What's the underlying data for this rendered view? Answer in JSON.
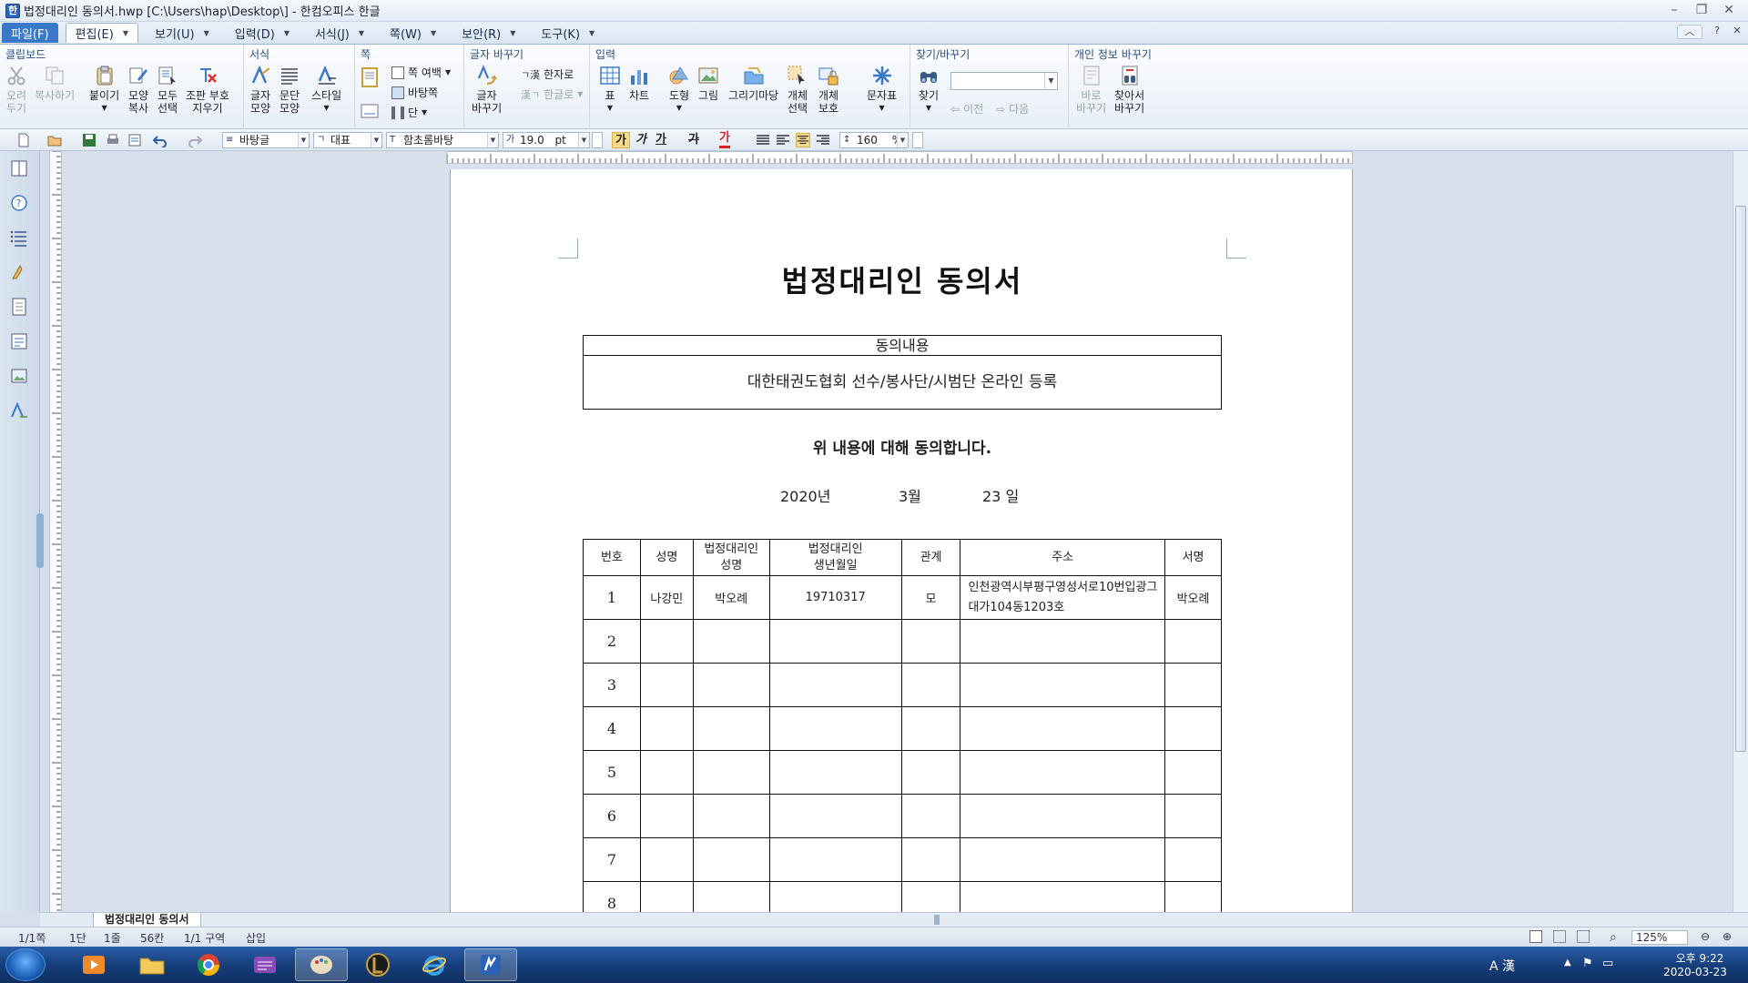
{
  "window": {
    "title": "법정대리인 동의서.hwp [C:\\Users\\hap\\Desktop\\] - 한컴오피스 한글"
  },
  "menu": [
    "파일(F)",
    "편집(E)",
    "보기(U)",
    "입력(D)",
    "서식(J)",
    "쪽(W)",
    "보안(R)",
    "도구(K)"
  ],
  "ribbon": {
    "groups": {
      "clipboard": "클립보드",
      "format": "서식",
      "page": "쪽",
      "char_replace": "글자 바꾸기",
      "insert": "입력",
      "find": "찾기/바꾸기",
      "privacy": "개인 정보 바꾸기"
    },
    "cut": [
      "오려",
      "두기"
    ],
    "copy": "복사하기",
    "paste": "붙이기",
    "shape_copy": [
      "모양",
      "복사"
    ],
    "select_all": [
      "모두",
      "선택"
    ],
    "clear_format": [
      "조판 부호",
      "지우기"
    ],
    "char_shape": [
      "글자",
      "모양"
    ],
    "para_shape": [
      "문단",
      "모양"
    ],
    "style": "스타일",
    "page_margin": "쪽 여백",
    "background_page": "바탕쪽",
    "column": "단",
    "char_convert": [
      "글자",
      "바꾸기"
    ],
    "hanja": "한자로",
    "hangul": "한글로",
    "table": "표",
    "chart": "차트",
    "shape": "도형",
    "picture": "그림",
    "drawing_gallery": "그리기마당",
    "object_select": [
      "개체",
      "선택"
    ],
    "object_protect": [
      "개체",
      "보호"
    ],
    "symbol": "문자표",
    "find": "찾기",
    "prev": "이전",
    "next": "다음",
    "replace_now": [
      "바로",
      "바꾸기"
    ],
    "find_replace": [
      "찾아서",
      "바꾸기"
    ]
  },
  "toolbar": {
    "style": "바탕글",
    "lang": "대표",
    "font": "함초롬바탕",
    "size": "19.0",
    "size_unit": "pt",
    "bold": "가",
    "italic": "가",
    "underline": "가",
    "strike": "가",
    "color": "가",
    "line_spacing": "160",
    "line_spacing_unit": "%"
  },
  "document": {
    "title": "법정대리인 동의서",
    "consent_header": "동의내용",
    "consent_body": "대한태권도협회 선수/봉사단/시범단 온라인 등록",
    "agree_text": "위 내용에 대해 동의합니다.",
    "date": {
      "year": "2020년",
      "month": "3월",
      "day": "23 일"
    },
    "columns": [
      "번호",
      "성명",
      "법정대리인 성명",
      "법정대리인 생년월일",
      "관계",
      "주소",
      "서명"
    ],
    "rows": [
      {
        "no": "1",
        "name": "나강민",
        "guardian": "박오례",
        "birth": "19710317",
        "relation": "모",
        "address": "인천광역시부평구영성서로10번입광그대가104동1203호",
        "sign": "박오례"
      },
      {
        "no": "2",
        "name": "",
        "guardian": "",
        "birth": "",
        "relation": "",
        "address": "",
        "sign": ""
      },
      {
        "no": "3",
        "name": "",
        "guardian": "",
        "birth": "",
        "relation": "",
        "address": "",
        "sign": ""
      },
      {
        "no": "4",
        "name": "",
        "guardian": "",
        "birth": "",
        "relation": "",
        "address": "",
        "sign": ""
      },
      {
        "no": "5",
        "name": "",
        "guardian": "",
        "birth": "",
        "relation": "",
        "address": "",
        "sign": ""
      },
      {
        "no": "6",
        "name": "",
        "guardian": "",
        "birth": "",
        "relation": "",
        "address": "",
        "sign": ""
      },
      {
        "no": "7",
        "name": "",
        "guardian": "",
        "birth": "",
        "relation": "",
        "address": "",
        "sign": ""
      },
      {
        "no": "8",
        "name": "",
        "guardian": "",
        "birth": "",
        "relation": "",
        "address": "",
        "sign": ""
      }
    ]
  },
  "tab": "법정대리인 동의서",
  "status": {
    "page": "1/1쪽",
    "column": "1단",
    "line": "1줄",
    "col": "56칸",
    "section": "1/1 구역",
    "mode": "삽입",
    "zoom": "125%"
  },
  "taskbar": {
    "ime": "A 漢",
    "time": "오후 9:22",
    "date": "2020-03-23"
  },
  "colors": {
    "accent": "#3a78c8",
    "ribbon_title": "#2b4f80",
    "taskbar": "#1a4a8c"
  }
}
